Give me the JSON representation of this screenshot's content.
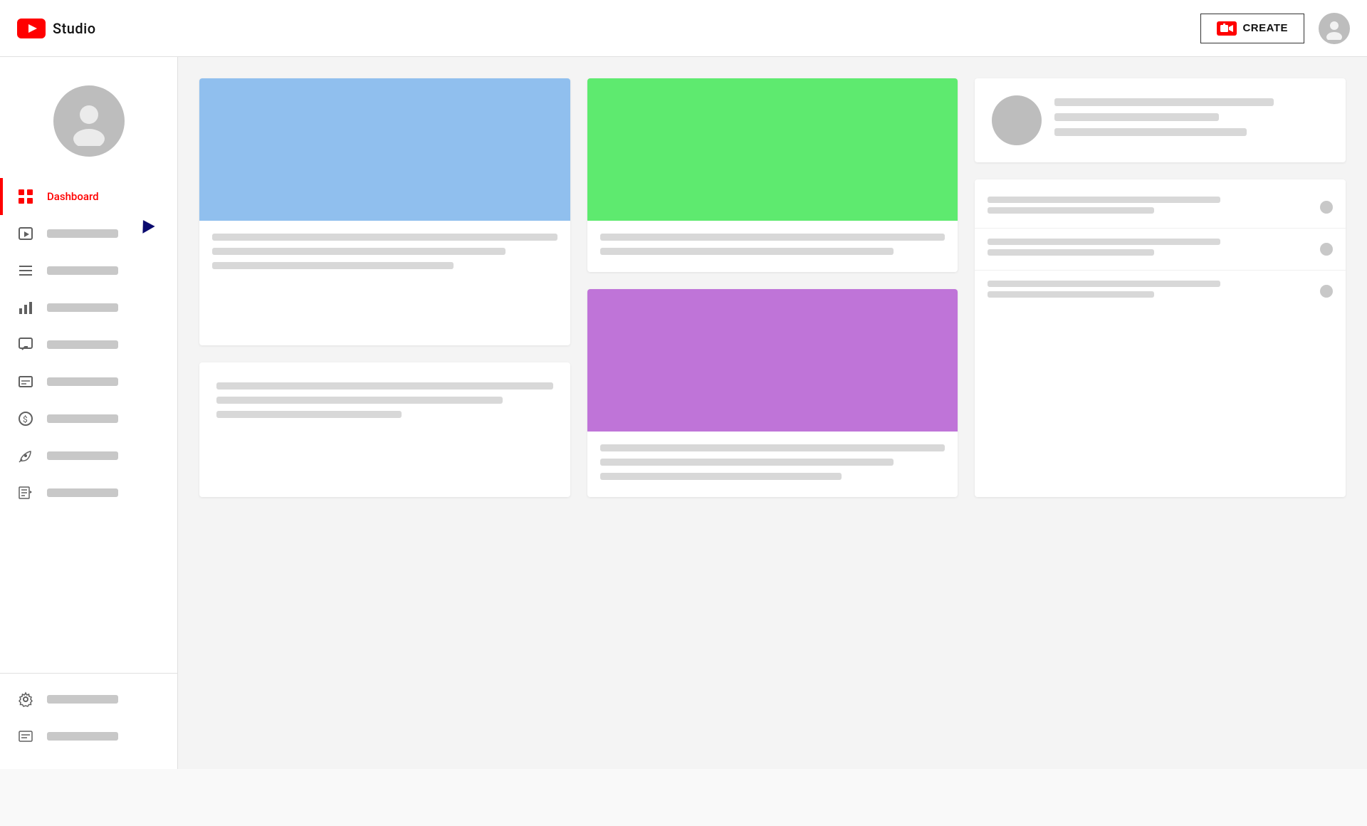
{
  "header": {
    "logo_text": "Studio",
    "create_label": "CREATE"
  },
  "sidebar": {
    "nav_items": [
      {
        "id": "dashboard",
        "label": "Dashboard",
        "active": true
      },
      {
        "id": "content",
        "label": "Content",
        "active": false
      },
      {
        "id": "playlists",
        "label": "Playlists",
        "active": false
      },
      {
        "id": "analytics",
        "label": "Analytics",
        "active": false
      },
      {
        "id": "comments",
        "label": "Comments",
        "active": false
      },
      {
        "id": "subtitles",
        "label": "Subtitles",
        "active": false
      },
      {
        "id": "monetization",
        "label": "Monetization",
        "active": false
      },
      {
        "id": "customization",
        "label": "Customization",
        "active": false
      },
      {
        "id": "audio-library",
        "label": "Audio Library",
        "active": false
      }
    ],
    "bottom_items": [
      {
        "id": "settings",
        "label": "Settings"
      },
      {
        "id": "feedback",
        "label": "Send Feedback"
      }
    ]
  },
  "main": {
    "cards": [
      {
        "id": "card1",
        "type": "thumbnail-blue"
      },
      {
        "id": "card2",
        "type": "thumbnail-green-purple"
      },
      {
        "id": "card3",
        "type": "channel-info"
      },
      {
        "id": "card4",
        "type": "text-only"
      },
      {
        "id": "card5",
        "type": "list"
      }
    ]
  }
}
